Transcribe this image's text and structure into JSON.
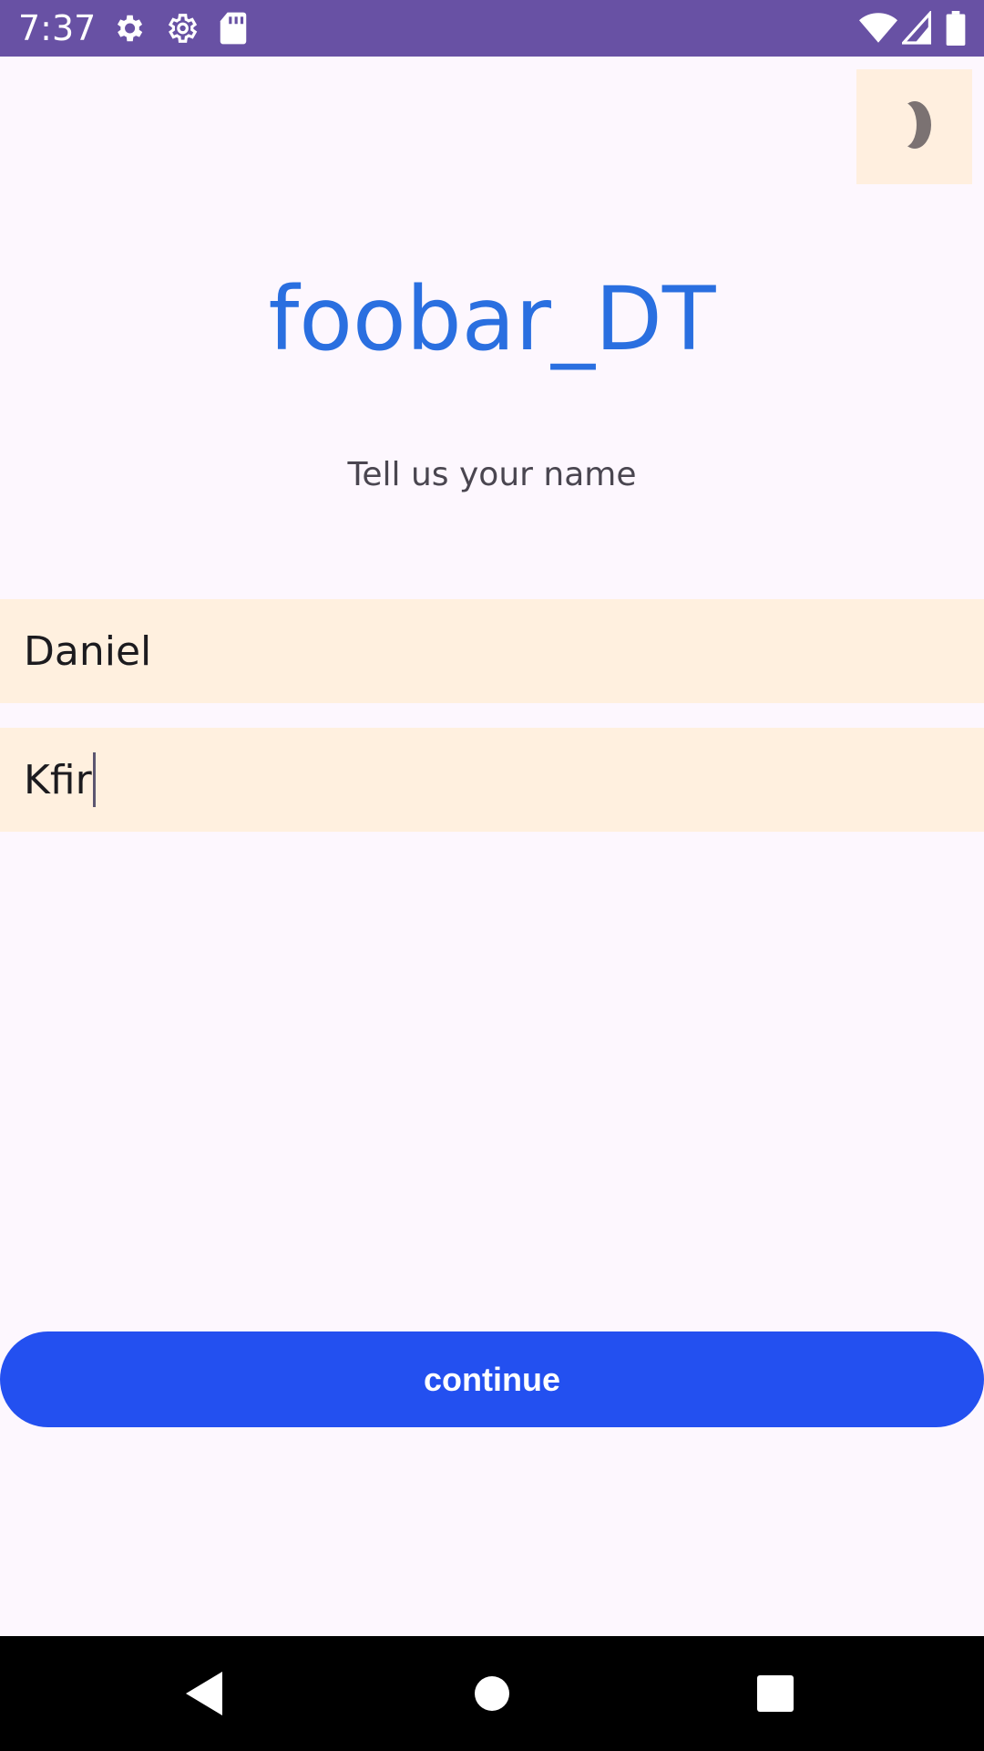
{
  "status_bar": {
    "time": "7:37",
    "left_icons": [
      "gear-icon",
      "gear-outline-icon",
      "sd-card-icon"
    ],
    "right_icons": [
      "wifi-icon",
      "signal-icon",
      "battery-icon"
    ],
    "color": "#6851A4"
  },
  "header": {
    "theme_toggle_icon": "moon-icon"
  },
  "main": {
    "title": "foobar_DT",
    "subtitle": "Tell us your name",
    "first_name": {
      "value": "Daniel"
    },
    "last_name": {
      "value": "Kfir"
    },
    "continue_label": "continue"
  },
  "nav_bar": {
    "buttons": [
      "back-icon",
      "home-icon",
      "recents-icon"
    ]
  },
  "colors": {
    "background": "#FDF7FE",
    "accent": "#2A6FE0",
    "button": "#2350F0",
    "field_background": "#FFF0DF"
  }
}
